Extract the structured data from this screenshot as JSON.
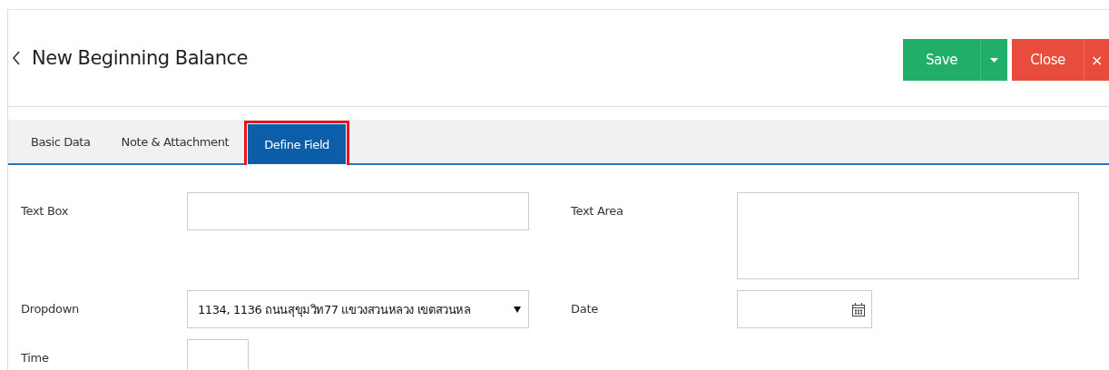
{
  "header": {
    "title": "New Beginning Balance",
    "buttons": [
      {
        "kind": "save",
        "label": "Save"
      },
      {
        "kind": "close",
        "label": "Close",
        "icon": "×"
      }
    ]
  },
  "tabs": [
    {
      "label": "Basic Data",
      "selected": false,
      "highlighted": false
    },
    {
      "label": "Note & Attachment",
      "selected": false,
      "highlighted": false
    },
    {
      "label": "Define Field",
      "selected": true,
      "highlighted": true
    }
  ],
  "fields": [
    {
      "label": "Text Box",
      "kind": "text"
    },
    {
      "label": "Text Area",
      "kind": "textarea"
    },
    {
      "label": "Dropdown",
      "kind": "select",
      "value": "1134, 1136 ถนนสุขุมวิท77 แขวงสวนหลวง เขตสวนหล"
    },
    {
      "label": "Date",
      "kind": "date"
    },
    {
      "label": "Time",
      "kind": "time"
    }
  ]
}
